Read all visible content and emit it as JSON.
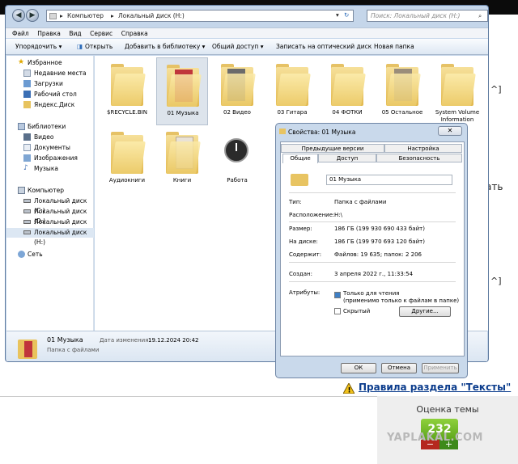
{
  "explorer": {
    "breadcrumb": [
      "Компьютер",
      "Локальный диск (H:)"
    ],
    "search_placeholder": "Поиск: Локальный диск (H:)",
    "menu": [
      "Файл",
      "Правка",
      "Вид",
      "Сервис",
      "Справка"
    ],
    "toolbar": [
      "Упорядочить",
      "Открыть",
      "Добавить в библиотеку",
      "Общий доступ",
      "Записать на оптический диск",
      "Новая папка"
    ],
    "nav": {
      "favorites": "Избранное",
      "favorites_items": [
        "Недавние места",
        "Загрузки",
        "Рабочий стол",
        "Яндекс.Диск"
      ],
      "libraries": "Библиотеки",
      "libraries_items": [
        "Видео",
        "Документы",
        "Изображения",
        "Музыка"
      ],
      "computer": "Компьютер",
      "computer_items": [
        "Локальный диск (C:)",
        "Локальный диск (D:)",
        "Локальный диск (F:)",
        "Локальный диск (H:)"
      ],
      "network": "Сеть"
    },
    "items": [
      "$RECYCLE.BIN",
      "01 Музыка",
      "02 Видео",
      "03 Гитара",
      "04 ФОТКИ",
      "05 Остальное",
      "System Volume Information",
      "Аудиокниги",
      "Книги",
      "Работа"
    ],
    "status": {
      "name": "01 Музыка",
      "modified_label": "Дата изменения:",
      "modified_value": "19.12.2024 20:42",
      "type": "Папка с файлами"
    }
  },
  "dialog": {
    "title": "Свойства: 01 Музыка",
    "close": "✕",
    "tabs_top": [
      "Предыдущие версии",
      "Настройка"
    ],
    "tabs_bottom": [
      "Общие",
      "Доступ",
      "Безопасность"
    ],
    "name": "01 Музыка",
    "rows": [
      {
        "label": "Тип:",
        "value": "Папка с файлами"
      },
      {
        "label": "Расположение:",
        "value": "H:\\"
      },
      {
        "label": "Размер:",
        "value": "186 ГБ (199 930 690 433 байт)"
      },
      {
        "label": "На диске:",
        "value": "186 ГБ (199 970 693 120 байт)"
      },
      {
        "label": "Содержит:",
        "value": "Файлов: 19 635; папок: 2 206"
      },
      {
        "label": "Создан:",
        "value": "3 апреля 2022 г., 11:33:54"
      }
    ],
    "attributes_label": "Атрибуты:",
    "readonly": "Только для чтения",
    "readonly_note": "(применимо только к файлам в папке)",
    "hidden": "Скрытый",
    "other": "Другие...",
    "ok": "ОК",
    "cancel": "Отмена",
    "apply": "Применить"
  },
  "page": {
    "rules_link": "Правила раздела \"Тексты\"",
    "rating_title": "Оценка темы",
    "rating_value": "232",
    "minus": "−",
    "plus": "+",
    "watermark": "YAPLAKAL.COM",
    "side_fragment_1": "^]",
    "side_fragment_2": "ать",
    "side_fragment_3": "^]"
  }
}
